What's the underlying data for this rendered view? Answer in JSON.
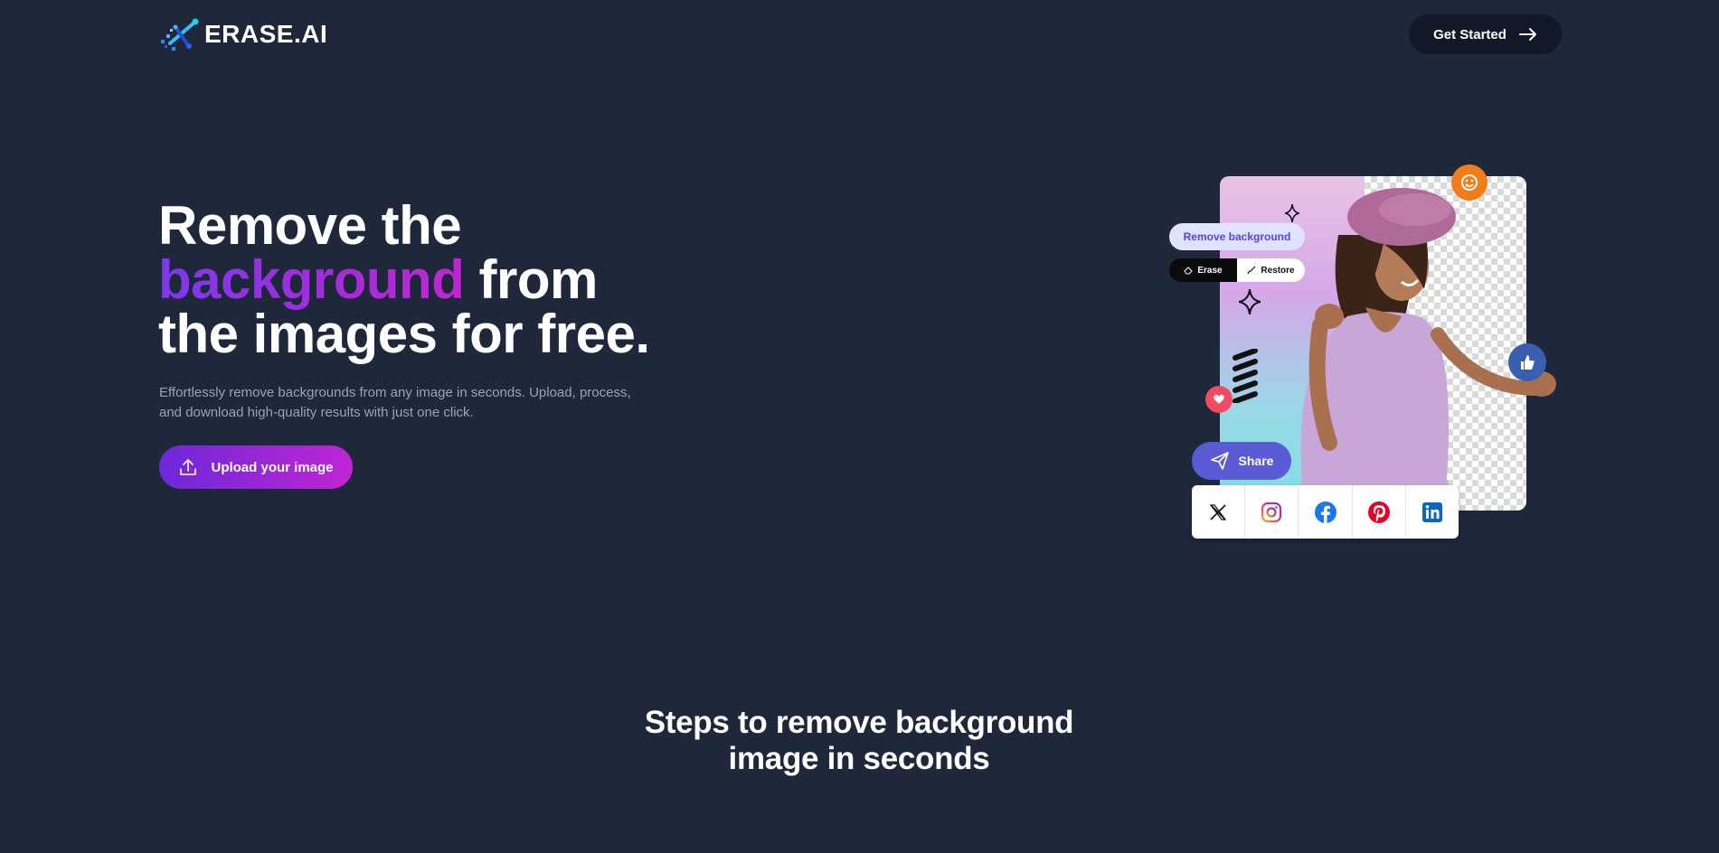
{
  "header": {
    "brand": "ERASE.AI",
    "cta_label": "Get Started"
  },
  "hero": {
    "title_line1": "Remove the",
    "title_highlight": "background",
    "title_line2_rest": " from",
    "title_line3": "the images for free.",
    "subtitle_line1": "Effortlessly remove backgrounds from any image in seconds. Upload, process,",
    "subtitle_line2": "and download high-quality results with just one click.",
    "upload_label": "Upload your image"
  },
  "illustration": {
    "remove_bg_label": "Remove background",
    "erase_label": "Erase",
    "restore_label": "Restore",
    "share_label": "Share",
    "social_icons": [
      "x-icon",
      "instagram-icon",
      "facebook-icon",
      "pinterest-icon",
      "linkedin-icon"
    ]
  },
  "steps": {
    "title_line1": "Steps to remove background",
    "title_line2": "image in seconds"
  },
  "colors": {
    "background": "#1f283b",
    "accent_start": "#6d28d9",
    "accent_end": "#c026d3",
    "dark_button": "#111827"
  }
}
